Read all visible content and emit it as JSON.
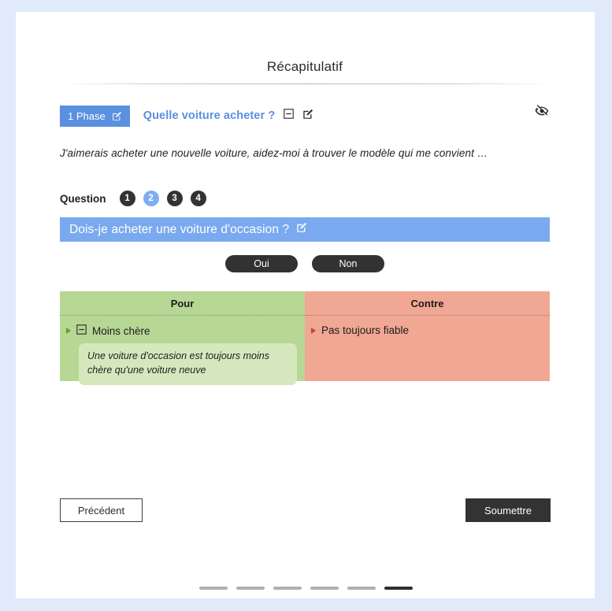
{
  "page": {
    "title": "Récapitulatif"
  },
  "phase": {
    "badge_label": "1 Phase",
    "badge_edit_icon": "edit-icon",
    "topic_title": "Quelle voiture acheter ?",
    "collapse_icon": "minus-square-icon",
    "edit_icon": "edit-icon",
    "visibility_icon": "eye-off-icon",
    "intro_text": "J'aimerais acheter une nouvelle voiture, aidez-moi à trouver le modèle qui me convient …",
    "accent_color": "#5b8fe0"
  },
  "question_nav": {
    "label": "Question",
    "items": [
      {
        "number": "1",
        "active": false
      },
      {
        "number": "2",
        "active": true
      },
      {
        "number": "3",
        "active": false
      },
      {
        "number": "4",
        "active": false
      }
    ],
    "active_color": "#7daef2",
    "inactive_color": "#333333"
  },
  "question": {
    "text": "Dois-je acheter une voiture d'occasion ?",
    "edit_icon": "edit-icon",
    "banner_color": "#7aa9ef"
  },
  "answers": {
    "yes_label": "Oui",
    "no_label": "Non"
  },
  "pros_cons": {
    "pros": {
      "header": "Pour",
      "color": "#b7d795",
      "items": [
        {
          "marker_icon": "triangle-right-icon",
          "collapse_icon": "minus-square-icon",
          "label": "Moins chère",
          "note": "Une voiture d'occasion est toujours moins chère qu'une voiture neuve"
        }
      ]
    },
    "cons": {
      "header": "Contre",
      "color": "#f0a793",
      "items": [
        {
          "marker_icon": "triangle-right-icon",
          "label": "Pas toujours fiable"
        }
      ]
    }
  },
  "footer": {
    "previous_label": "Précédent",
    "submit_label": "Soumettre"
  },
  "progress": {
    "total": 6,
    "active_index": 6,
    "active_color": "#2e2e2e",
    "inactive_color": "#b0b0b0"
  }
}
